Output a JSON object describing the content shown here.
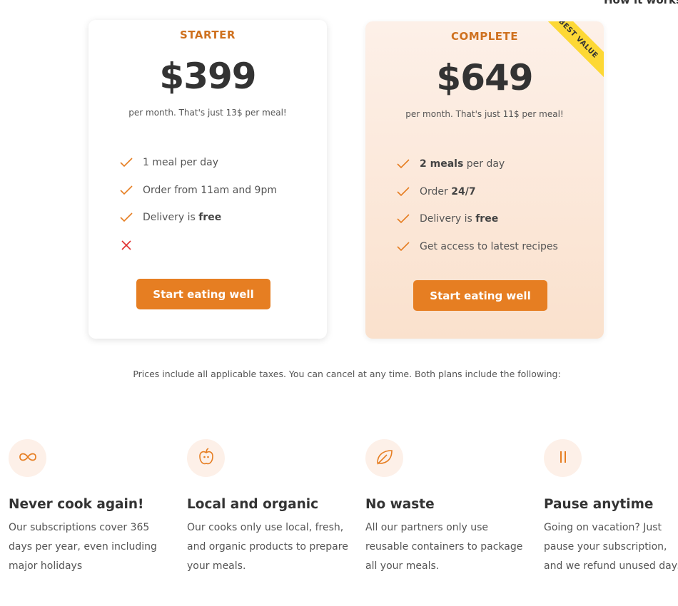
{
  "nav": {
    "how_it_works": "How it works"
  },
  "plans": [
    {
      "name": "STARTER",
      "price": "$399",
      "per_month": "per month. That's just 13$ per meal!",
      "features": [
        {
          "pre": "1 meal per day",
          "bold": "",
          "post": "",
          "included": true
        },
        {
          "pre": "Order from 11am and 9pm",
          "bold": "",
          "post": "",
          "included": true
        },
        {
          "pre": "Delivery is ",
          "bold": "free",
          "post": "",
          "included": true
        },
        {
          "pre": "",
          "bold": "",
          "post": "",
          "included": false
        }
      ],
      "cta": "Start eating well"
    },
    {
      "name": "COMPLETE",
      "price": "$649",
      "per_month": "per month. That's just 11$ per meal!",
      "ribbon": "BEST VALUE",
      "features": [
        {
          "pre": "",
          "bold": "2 meals",
          "post": " per day",
          "included": true
        },
        {
          "pre": "Order ",
          "bold": "24/7",
          "post": "",
          "included": true
        },
        {
          "pre": "Delivery is ",
          "bold": "free",
          "post": "",
          "included": true
        },
        {
          "pre": "Get access to latest recipes",
          "bold": "",
          "post": "",
          "included": true
        }
      ],
      "cta": "Start eating well"
    }
  ],
  "note": "Prices include all applicable taxes. You can cancel at any time. Both plans include the following:",
  "features": [
    {
      "icon": "infinity-icon",
      "title": "Never cook again!",
      "text": "Our subscriptions cover 365 days per year, even including major holidays"
    },
    {
      "icon": "apple-icon",
      "title": "Local and organic",
      "text": "Our cooks only use local, fresh, and organic products to prepare your meals."
    },
    {
      "icon": "leaf-icon",
      "title": "No waste",
      "text": "All our partners only use reusable containers to package all your meals."
    },
    {
      "icon": "pause-icon",
      "title": "Pause anytime",
      "text": "Going on vacation? Just pause your subscription, and we refund unused days"
    }
  ],
  "colors": {
    "accent": "#e67e22",
    "accent_text": "#cf711f",
    "ribbon": "#fdd835",
    "cross": "#e03131",
    "tint": "#fdf0e8"
  }
}
